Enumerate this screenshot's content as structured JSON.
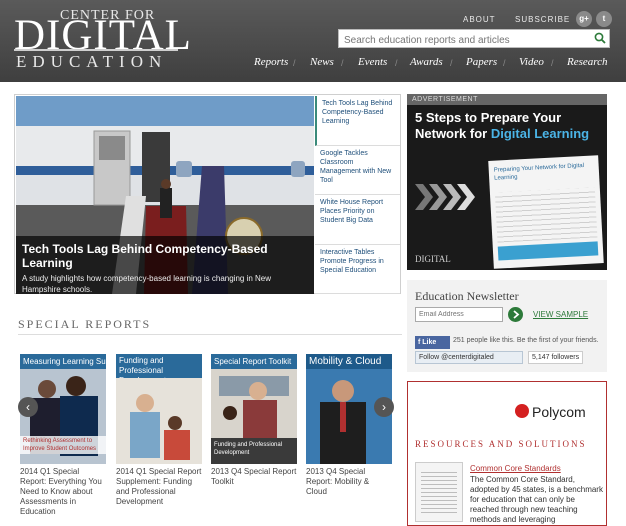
{
  "header": {
    "logo_top": "CENTER FOR",
    "logo_main": "DIGITAL",
    "logo_bottom": "EDUCATION",
    "about": "ABOUT",
    "subscribe": "SUBSCRIBE",
    "social": [
      {
        "icon": "google-plus-icon",
        "glyph": "g+"
      },
      {
        "icon": "twitter-icon",
        "glyph": "t"
      }
    ],
    "search_placeholder": "Search education reports and articles",
    "nav": [
      "Reports",
      "News",
      "Events",
      "Awards",
      "Papers",
      "Video",
      "Research"
    ]
  },
  "hero": {
    "title": "Tech Tools Lag Behind Competency-Based Learning",
    "description": "A study highlights how competency-based learning is changing in New Hampshire schools.",
    "stories": [
      "Tech Tools Lag Behind Competency-Based Learning",
      "Google Tackles Classroom Management with New Tool",
      "White House Report Places Priority on Student Big Data",
      "Interactive Tables Promote Progress in Special Education"
    ]
  },
  "ad": {
    "label": "ADVERTISEMENT",
    "headline": "5 Steps to Prepare Your Network for",
    "headline_highlight": "Digital Learning",
    "brief_title": "Preparing Your Network for Digital Learning",
    "brief_logo": "DIGITAL"
  },
  "newsletter": {
    "title": "Education Newsletter",
    "placeholder": "Email Address",
    "view_sample": "VIEW SAMPLE",
    "fb_like": "Like",
    "fb_text": "251 people like this. Be the first of your friends.",
    "twitter_follow": "Follow @centerdigitaled",
    "twitter_count": "5,147 followers"
  },
  "sponsor": {
    "logo": "Polycom",
    "heading": "RESOURCES AND SOLUTIONS",
    "link": "Common Core Standards",
    "description": "The Common Core Standard, adopted by 45 states, is a benchmark for education that can only be reached through new teaching methods and leveraging"
  },
  "special_reports": {
    "heading": "SPECIAL REPORTS",
    "cards": [
      {
        "cover": "Measuring Learning Success",
        "cover_sub": "Rethinking Assessment to Improve Student Outcomes",
        "caption": "2014 Q1 Special Report: Everything You Need to Know about Assessments in Education"
      },
      {
        "cover": "Funding and Professional Development",
        "cover_sub": "",
        "caption": "2014 Q1 Special Report Supplement: Funding and Professional Development"
      },
      {
        "cover": "Special Report Toolkit",
        "cover_sub": "Funding and Professional Development",
        "caption": "2013 Q4 Special Report Toolkit"
      },
      {
        "cover": "Mobility & Cloud",
        "cover_sub": "",
        "caption": "2013 Q4 Special Report: Mobility & Cloud"
      }
    ],
    "prev": "‹",
    "next": "›"
  },
  "colors": {
    "accent": "#2d7a3a",
    "sponsor": "#b03030",
    "ad_highlight": "#4bb4e6"
  }
}
